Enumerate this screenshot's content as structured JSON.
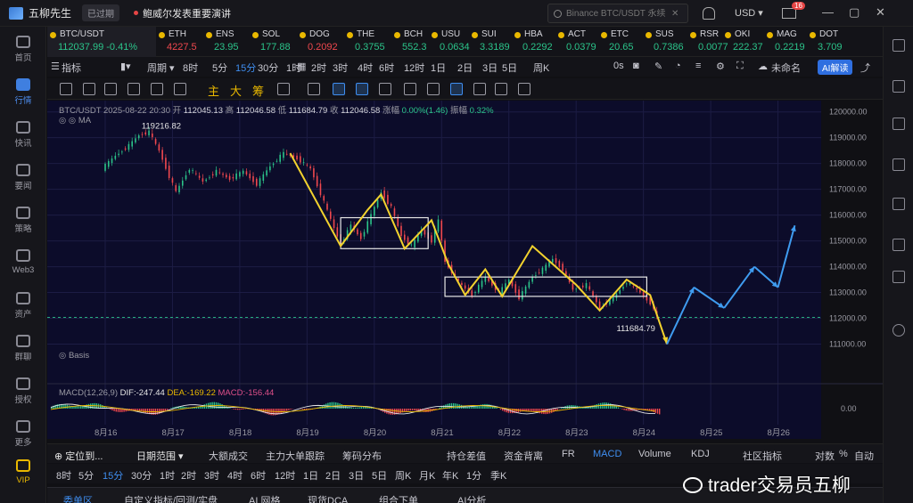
{
  "app": {
    "name": "五柳先生",
    "expired_badge": "已过期",
    "news": "鲍威尔发表重要演讲",
    "search_placeholder": "Binance BTC/USDT 永续",
    "currency": "USD",
    "mail_count": "16"
  },
  "left_nav": [
    {
      "label": "首页",
      "icon": "home-icon"
    },
    {
      "label": "行情",
      "icon": "chart-bars-icon",
      "active": true
    },
    {
      "label": "快讯",
      "icon": "flash-news-icon"
    },
    {
      "label": "要闻",
      "icon": "newspaper-icon"
    },
    {
      "label": "策略",
      "icon": "robot-icon"
    },
    {
      "label": "Web3",
      "icon": "web3-icon"
    },
    {
      "label": "资产",
      "icon": "wallet-icon"
    },
    {
      "label": "群聊",
      "icon": "chat-icon"
    },
    {
      "label": "授权",
      "icon": "key-icon"
    },
    {
      "label": "更多",
      "icon": "grid-icon"
    },
    {
      "label": "VIP",
      "icon": "vip-diamond-icon",
      "vip": true
    }
  ],
  "tickers": [
    {
      "sym": "BTC/USDT",
      "val": "112037.99 -0.41%",
      "dir": "up",
      "active": true
    },
    {
      "sym": "ETH",
      "val": "4227.5",
      "dir": "down"
    },
    {
      "sym": "ENS",
      "val": "23.95",
      "dir": "up"
    },
    {
      "sym": "SOL",
      "val": "177.88",
      "dir": "up"
    },
    {
      "sym": "DOG",
      "val": "0.2092",
      "dir": "down"
    },
    {
      "sym": "THE",
      "val": "0.3755",
      "dir": "up"
    },
    {
      "sym": "BCH",
      "val": "552.3",
      "dir": "up"
    },
    {
      "sym": "USU",
      "val": "0.0634",
      "dir": "up"
    },
    {
      "sym": "SUI",
      "val": "3.3189",
      "dir": "up"
    },
    {
      "sym": "HBA",
      "val": "0.2292",
      "dir": "up"
    },
    {
      "sym": "ACT",
      "val": "0.0379",
      "dir": "up"
    },
    {
      "sym": "ETC",
      "val": "20.65",
      "dir": "up"
    },
    {
      "sym": "SUS",
      "val": "0.7386",
      "dir": "up"
    },
    {
      "sym": "RSR",
      "val": "0.0077",
      "dir": "up"
    },
    {
      "sym": "OKI",
      "val": "222.37",
      "dir": "up"
    },
    {
      "sym": "MAG",
      "val": "0.2219",
      "dir": "up"
    },
    {
      "sym": "DOT",
      "val": "3.709",
      "dir": "up"
    }
  ],
  "toolbar1": {
    "items": [
      "指标",
      "周期",
      "8时",
      "5分",
      "15分",
      "30分",
      "1时",
      "2时",
      "3时",
      "4时",
      "6时",
      "12时",
      "1日",
      "2日",
      "3日",
      "5日",
      "周K"
    ],
    "active": "15分",
    "zero_s": "0s",
    "layout_name": "未命名",
    "ai_label": "AI解读"
  },
  "draw_text_tools": [
    "主",
    "大",
    "筹"
  ],
  "chart_header": {
    "pair": "BTC/USDT",
    "datetime": "2025-08-22 20:30",
    "open_label": "开",
    "open": "112045.13",
    "high_label": "高",
    "high": "112046.58",
    "low_label": "低",
    "low": "111684.79",
    "close_label": "收",
    "close": "112046.58",
    "change_label": "涨幅",
    "change": "0.00%(1.46)",
    "amp_label": "振幅",
    "amp": "0.32%",
    "ma_label": "MA",
    "basis_label": "Basis",
    "macd_name": "MACD(12,26,9)",
    "dif": "DIF:-247.44",
    "dea": "DEA:-169.22",
    "macd": "MACD:-156.44"
  },
  "chart_data": {
    "type": "line",
    "title": "",
    "x_ticks": [
      "8月16",
      "8月17",
      "8月18",
      "8月19",
      "8月20",
      "8月21",
      "8月22",
      "8月23",
      "8月24",
      "8月25",
      "8月26"
    ],
    "y_ticks": [
      "120000.00",
      "119000.00",
      "118000.00",
      "117000.00",
      "116000.00",
      "115000.00",
      "114000.00",
      "113000.00",
      "112000.00",
      "111000.00"
    ],
    "y_range": [
      110500,
      120300
    ],
    "macd_tick": "0.00",
    "annotations": {
      "high": "119216.82",
      "low": "111684.79"
    },
    "price_series": [
      {
        "t": 0.0,
        "v": 117800
      },
      {
        "t": 0.2,
        "v": 118300
      },
      {
        "t": 0.4,
        "v": 118700
      },
      {
        "t": 0.55,
        "v": 119100
      },
      {
        "t": 0.7,
        "v": 119217
      },
      {
        "t": 0.85,
        "v": 118500
      },
      {
        "t": 1.0,
        "v": 117500
      },
      {
        "t": 1.1,
        "v": 116900
      },
      {
        "t": 1.3,
        "v": 117800
      },
      {
        "t": 1.5,
        "v": 117300
      },
      {
        "t": 1.7,
        "v": 117700
      },
      {
        "t": 1.9,
        "v": 117400
      },
      {
        "t": 2.1,
        "v": 117700
      },
      {
        "t": 2.3,
        "v": 117200
      },
      {
        "t": 2.5,
        "v": 117900
      },
      {
        "t": 2.7,
        "v": 118400
      },
      {
        "t": 2.9,
        "v": 118200
      },
      {
        "t": 3.1,
        "v": 117800
      },
      {
        "t": 3.3,
        "v": 116500
      },
      {
        "t": 3.45,
        "v": 115500
      },
      {
        "t": 3.55,
        "v": 114900
      },
      {
        "t": 3.7,
        "v": 115600
      },
      {
        "t": 3.85,
        "v": 115100
      },
      {
        "t": 4.0,
        "v": 116000
      },
      {
        "t": 4.15,
        "v": 116900
      },
      {
        "t": 4.3,
        "v": 116300
      },
      {
        "t": 4.45,
        "v": 115200
      },
      {
        "t": 4.6,
        "v": 114800
      },
      {
        "t": 4.75,
        "v": 115400
      },
      {
        "t": 4.9,
        "v": 115000
      },
      {
        "t": 5.0,
        "v": 115800
      },
      {
        "t": 5.1,
        "v": 114200
      },
      {
        "t": 5.3,
        "v": 113400
      },
      {
        "t": 5.5,
        "v": 112900
      },
      {
        "t": 5.7,
        "v": 113600
      },
      {
        "t": 5.9,
        "v": 113000
      },
      {
        "t": 6.05,
        "v": 113500
      },
      {
        "t": 6.2,
        "v": 112800
      },
      {
        "t": 6.4,
        "v": 113600
      },
      {
        "t": 6.55,
        "v": 113900
      },
      {
        "t": 6.7,
        "v": 114300
      },
      {
        "t": 6.85,
        "v": 113900
      },
      {
        "t": 7.0,
        "v": 113100
      },
      {
        "t": 7.2,
        "v": 113300
      },
      {
        "t": 7.4,
        "v": 112400
      },
      {
        "t": 7.6,
        "v": 112800
      },
      {
        "t": 7.8,
        "v": 113400
      },
      {
        "t": 8.0,
        "v": 113000
      },
      {
        "t": 8.15,
        "v": 112600
      },
      {
        "t": 8.25,
        "v": 112046
      }
    ],
    "zigzag_yellow": [
      {
        "t": 2.75,
        "v": 118400
      },
      {
        "t": 3.5,
        "v": 114800
      },
      {
        "t": 3.9,
        "v": 116200
      },
      {
        "t": 4.1,
        "v": 116800
      },
      {
        "t": 4.45,
        "v": 114700
      },
      {
        "t": 4.85,
        "v": 115800
      },
      {
        "t": 5.1,
        "v": 114100
      },
      {
        "t": 5.35,
        "v": 112900
      },
      {
        "t": 5.65,
        "v": 113900
      },
      {
        "t": 5.9,
        "v": 112850
      },
      {
        "t": 6.35,
        "v": 114800
      },
      {
        "t": 7.0,
        "v": 113300
      },
      {
        "t": 7.35,
        "v": 112300
      },
      {
        "t": 7.75,
        "v": 113500
      },
      {
        "t": 8.1,
        "v": 112900
      },
      {
        "t": 8.35,
        "v": 111000
      }
    ],
    "projection_blue": [
      {
        "t": 8.35,
        "v": 111000
      },
      {
        "t": 8.75,
        "v": 113200
      },
      {
        "t": 9.2,
        "v": 112400
      },
      {
        "t": 9.65,
        "v": 114000
      },
      {
        "t": 10.0,
        "v": 113200
      },
      {
        "t": 10.25,
        "v": 115600
      }
    ],
    "boxes": [
      {
        "t0": 3.5,
        "t1": 4.8,
        "v0": 114700,
        "v1": 115900
      },
      {
        "t0": 5.05,
        "t1": 8.05,
        "v0": 112850,
        "v1": 113600
      }
    ],
    "current_price_line": 112037
  },
  "indicator_tabs": {
    "locate": "定位到...",
    "date_range": "日期范围",
    "items": [
      "大额成交",
      "主力大单跟踪",
      "筹码分布",
      "持仓差值",
      "资金背离",
      "FR",
      "MACD",
      "Volume",
      "KDJ",
      "社区指标",
      "对数",
      "%",
      "自动"
    ],
    "active": "MACD"
  },
  "period_bar": {
    "items": [
      "8时",
      "5分",
      "15分",
      "30分",
      "1时",
      "2时",
      "3时",
      "4时",
      "6时",
      "12时",
      "1日",
      "2日",
      "3日",
      "5日",
      "周K",
      "月K",
      "年K",
      "1分",
      "季K"
    ],
    "active": "15分"
  },
  "bottom_tabs": {
    "items": [
      "委单区",
      "自定义指标/回测/实盘",
      "AI 网格",
      "现货DCA",
      "组合下单",
      "AI分析"
    ],
    "active": "委单区"
  },
  "watermark": "trader交易员五柳"
}
